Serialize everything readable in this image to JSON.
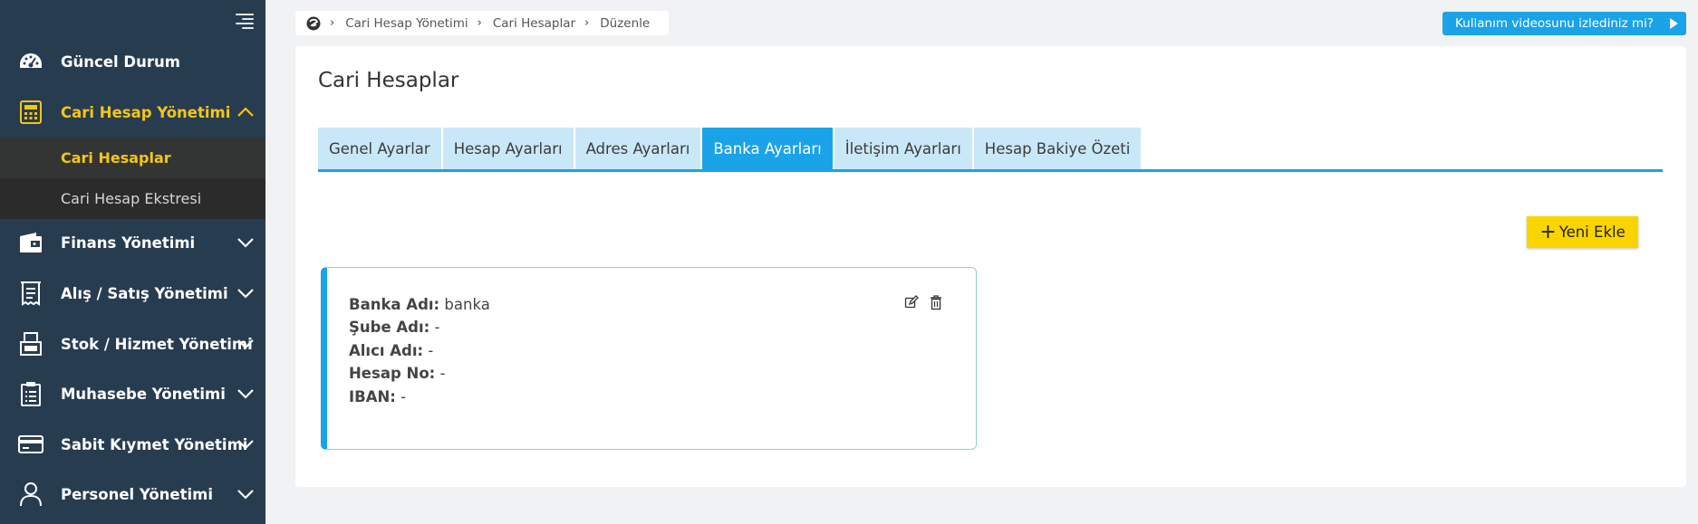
{
  "sidebar": {
    "items": [
      {
        "label": "Güncel Durum",
        "icon": "dashboard-icon"
      },
      {
        "label": "Cari Hesap Yönetimi",
        "icon": "calculator-icon",
        "expanded": true
      },
      {
        "label": "Finans Yönetimi",
        "icon": "wallet-icon"
      },
      {
        "label": "Alış / Satış Yönetimi",
        "icon": "receipt-icon"
      },
      {
        "label": "Stok / Hizmet Yönetimi",
        "icon": "stock-icon"
      },
      {
        "label": "Muhasebe Yönetimi",
        "icon": "clipboard-icon"
      },
      {
        "label": "Sabit Kıymet Yönetimi",
        "icon": "credit-card-icon"
      },
      {
        "label": "Personel Yönetimi",
        "icon": "user-icon"
      }
    ],
    "subitems": [
      {
        "label": "Cari Hesaplar"
      },
      {
        "label": "Cari Hesap Ekstresi"
      }
    ],
    "accent_color": "#f5c518"
  },
  "breadcrumb": {
    "items": [
      "Cari Hesap Yönetimi",
      "Cari Hesaplar",
      "Düzenle"
    ]
  },
  "video_prompt": "Kullanım videosunu izlediniz mi?",
  "page": {
    "title": "Cari Hesaplar",
    "tabs": [
      {
        "label": "Genel Ayarlar"
      },
      {
        "label": "Hesap Ayarları"
      },
      {
        "label": "Adres Ayarları"
      },
      {
        "label": "Banka Ayarları",
        "active": true
      },
      {
        "label": "İletişim Ayarları"
      },
      {
        "label": "Hesap Bakiye Özeti"
      }
    ],
    "add_button": "Yeni Ekle",
    "bank_card": {
      "fields": [
        {
          "label": "Banka Adı:",
          "value": "banka"
        },
        {
          "label": "Şube Adı:",
          "value": "-"
        },
        {
          "label": "Alıcı Adı:",
          "value": "-"
        },
        {
          "label": "Hesap No:",
          "value": "-"
        },
        {
          "label": "IBAN:",
          "value": "-"
        }
      ]
    }
  },
  "colors": {
    "sidebar_bg": "#283c50",
    "primary": "#1aa3e8",
    "tab_bg": "#c9e8f7",
    "add_button": "#f9d500"
  }
}
